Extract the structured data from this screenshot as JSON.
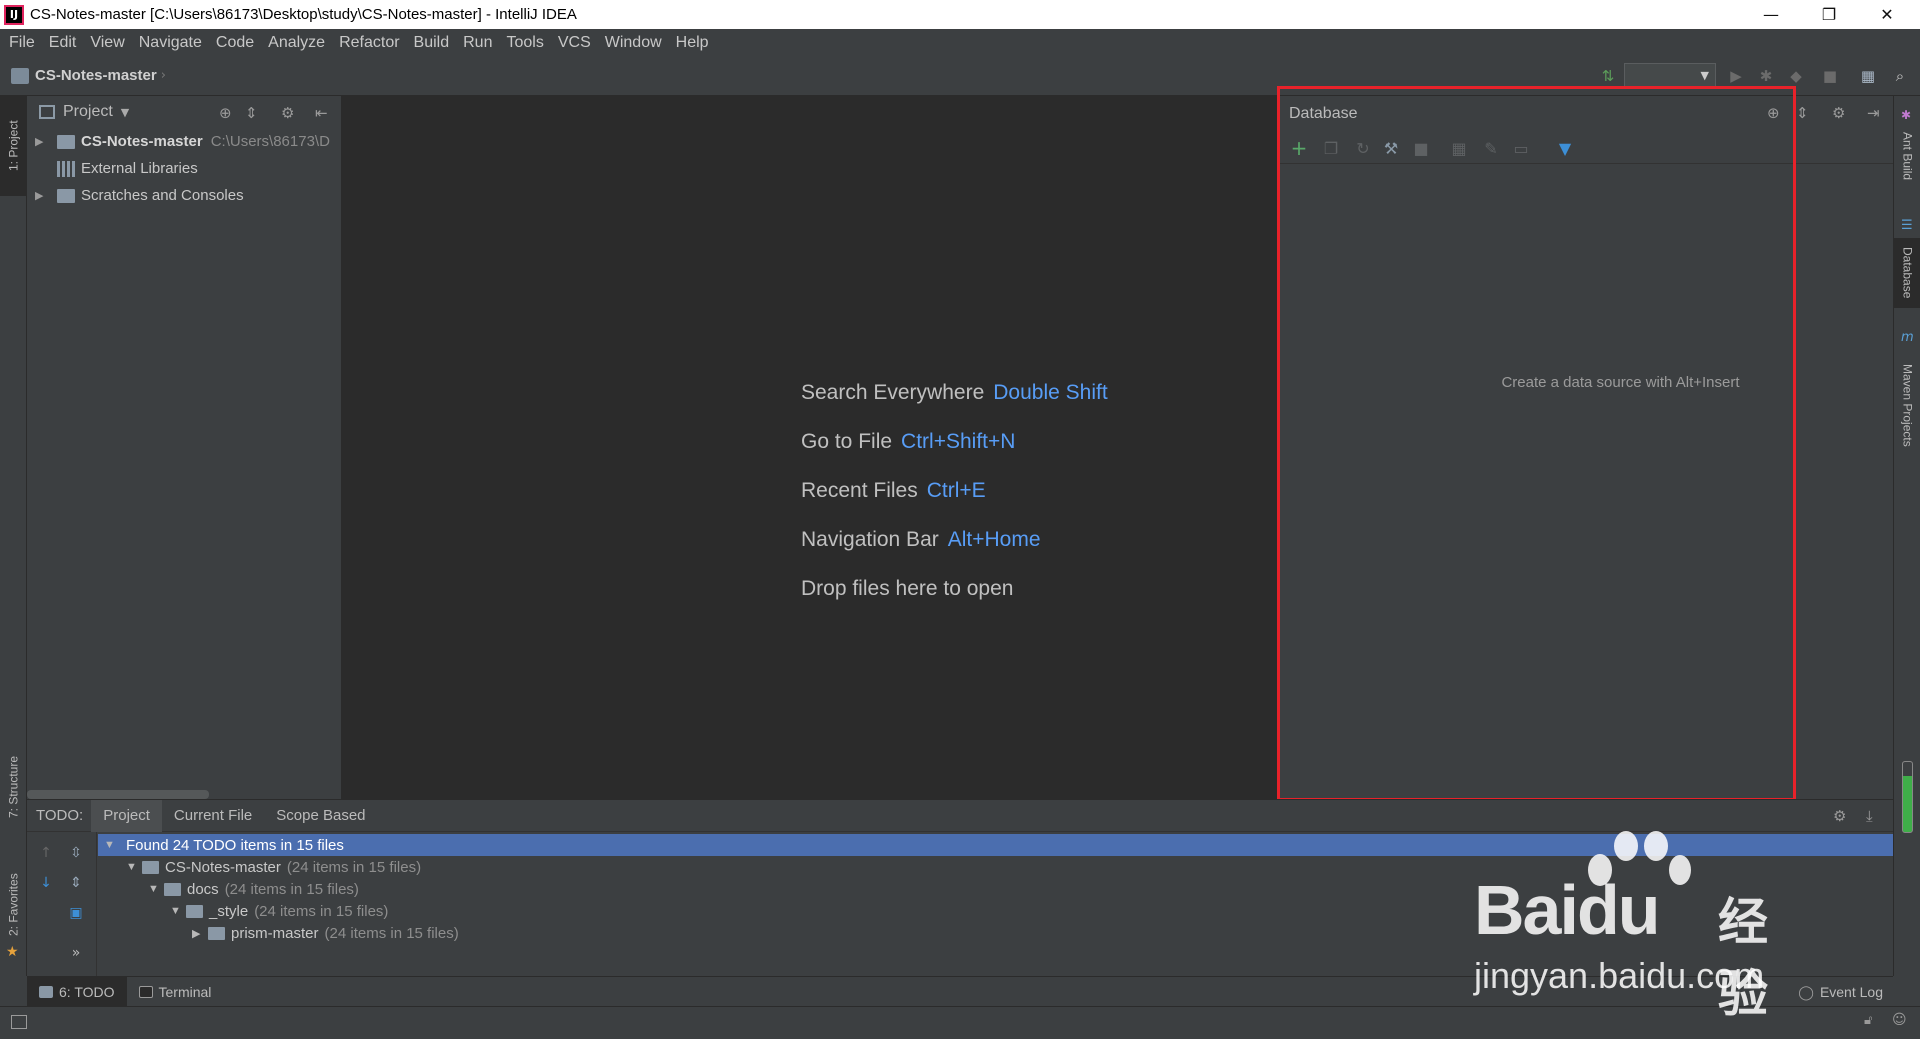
{
  "window": {
    "title": "CS-Notes-master [C:\\Users\\86173\\Desktop\\study\\CS-Notes-master] - IntelliJ IDEA",
    "app_icon": "IJ",
    "controls": {
      "minimize": "—",
      "restore": "❐",
      "close": "✕"
    }
  },
  "menu": [
    "File",
    "Edit",
    "View",
    "Navigate",
    "Code",
    "Analyze",
    "Refactor",
    "Build",
    "Run",
    "Tools",
    "VCS",
    "Window",
    "Help"
  ],
  "navbar": {
    "breadcrumb": "CS-Notes-master",
    "run_config_value": ""
  },
  "left_stripe": {
    "project_tab": "1: Project",
    "structure_tab": "7: Structure",
    "favorites_tab": "2: Favorites"
  },
  "right_stripe": {
    "ant_tab": "Ant Build",
    "database_tab": "Database",
    "maven_tab": "Maven Projects"
  },
  "project_panel": {
    "title": "Project",
    "tree": [
      {
        "label": "CS-Notes-master",
        "path": "C:\\Users\\86173\\D"
      },
      {
        "label": "External Libraries"
      },
      {
        "label": "Scratches and Consoles"
      }
    ]
  },
  "editor": {
    "hints": [
      {
        "text": "Search Everywhere",
        "shortcut": "Double Shift"
      },
      {
        "text": "Go to File",
        "shortcut": "Ctrl+Shift+N"
      },
      {
        "text": "Recent Files",
        "shortcut": "Ctrl+E"
      },
      {
        "text": "Navigation Bar",
        "shortcut": "Alt+Home"
      },
      {
        "text": "Drop files here to open",
        "shortcut": ""
      }
    ]
  },
  "database_panel": {
    "title": "Database",
    "empty_text": "Create a data source with Alt+Insert",
    "highlight_color": "#e8222a"
  },
  "todo_panel": {
    "label": "TODO:",
    "tabs": [
      "Project",
      "Current File",
      "Scope Based"
    ],
    "tree": [
      {
        "label": "Found 24 TODO items in 15 files",
        "count": ""
      },
      {
        "label": "CS-Notes-master",
        "count": "(24 items in 15 files)"
      },
      {
        "label": "docs",
        "count": "(24 items in 15 files)"
      },
      {
        "label": "_style",
        "count": "(24 items in 15 files)"
      },
      {
        "label": "prism-master",
        "count": "(24 items in 15 files)"
      }
    ],
    "more": "»"
  },
  "bottom_tabs": {
    "todo": "6: TODO",
    "terminal": "Terminal",
    "event_log": "Event Log"
  },
  "watermark": {
    "brand": "Bai",
    "brand_suffix": "du",
    "chinese": "经验",
    "url": "jingyan.baidu.com"
  },
  "colors": {
    "accent": "#589df6",
    "selection": "#4b6eaf",
    "editor_bg": "#2b2b2b",
    "panel_bg": "#3c3f41"
  }
}
